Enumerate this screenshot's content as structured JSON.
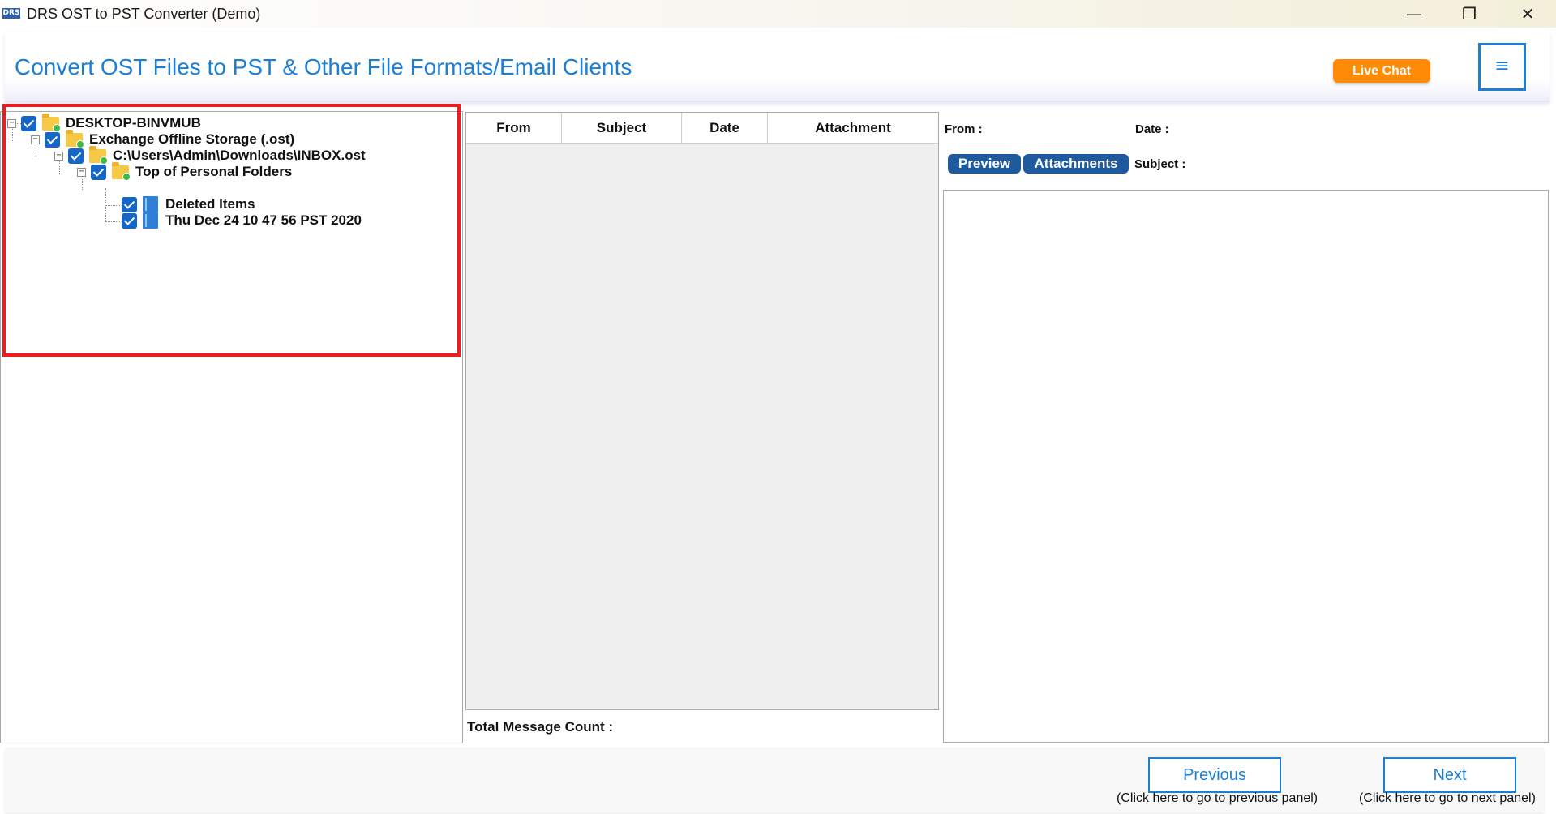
{
  "window": {
    "app_icon_text": "DRS",
    "title": "DRS OST to PST Converter (Demo)",
    "controls": {
      "minimize": "—",
      "maximize": "❐",
      "close": "✕"
    }
  },
  "header": {
    "title": "Convert OST Files to PST & Other File Formats/Email Clients",
    "live_chat_label": "Live Chat",
    "menu_glyph": "≡"
  },
  "tree": {
    "nodes": [
      {
        "label": "DESKTOP-BINVMUB",
        "checked": true,
        "icon": "folder-icon",
        "expander": "−"
      },
      {
        "label": "Exchange Offline Storage (.ost)",
        "checked": true,
        "icon": "folder-icon",
        "expander": "−"
      },
      {
        "label": "C:\\Users\\Admin\\Downloads\\INBOX.ost",
        "checked": true,
        "icon": "folder-icon",
        "expander": "−"
      },
      {
        "label": "Top of Personal Folders",
        "checked": true,
        "icon": "folder-icon",
        "expander": "−"
      },
      {
        "label": "Deleted Items",
        "checked": true,
        "icon": "mailbox-folder-icon"
      },
      {
        "label": "Thu Dec 24 10 47 56 PST 2020",
        "checked": true,
        "icon": "mailbox-folder-icon"
      }
    ]
  },
  "message_list": {
    "columns": [
      "From",
      "Subject",
      "Date",
      "Attachment"
    ],
    "rows": [],
    "total_label": "Total Message Count :"
  },
  "preview": {
    "from_label": "From :",
    "date_label": "Date :",
    "subject_label": "Subject :",
    "tabs": [
      "Preview",
      "Attachments"
    ]
  },
  "footer": {
    "previous_label": "Previous",
    "previous_hint": "(Click here to go to previous panel)",
    "next_label": "Next",
    "next_hint": "(Click here to go to next panel)"
  },
  "colors": {
    "accent": "#1c7fd6",
    "live_chat": "#ff8a05",
    "tab": "#1f5a9e",
    "highlight": "#ee1c1c",
    "checkbox": "#1466c7"
  }
}
